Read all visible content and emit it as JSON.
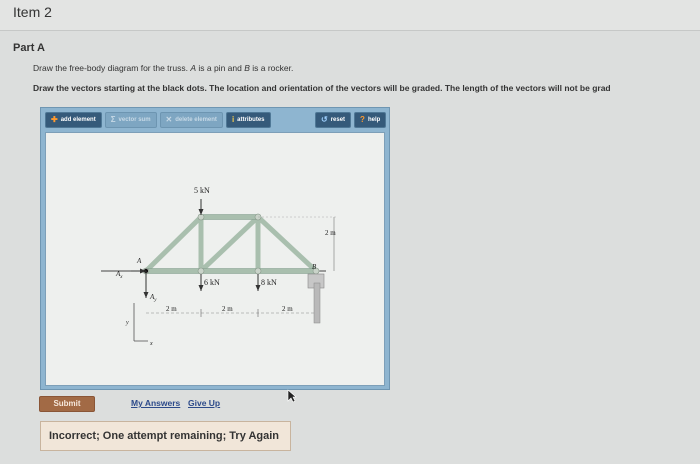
{
  "item": {
    "title": "Item 2"
  },
  "part": {
    "title": "Part A",
    "instruction_prefix": "Draw the free-body diagram for the truss. ",
    "instruction_var_a": "A",
    "instruction_mid1": " is a pin and ",
    "instruction_var_b": "B",
    "instruction_mid2": " is a rocker.",
    "instruction_bold": "Draw the vectors starting at the black dots. The location and orientation of the vectors will be graded. The length of the vectors will not be grad"
  },
  "toolbar": {
    "add_element": "add element",
    "vector_sum": "vector sum",
    "delete_element": "delete element",
    "attributes": "attributes",
    "reset": "reset",
    "help": "help"
  },
  "diagram": {
    "load_top": "5 kN",
    "load_mid": "6 kN",
    "load_right": "8 kN",
    "dim_1": "2 m",
    "dim_2": "2 m",
    "dim_3": "2 m",
    "height": "2 m",
    "label_a": "A",
    "label_b": "B",
    "label_ax": "A",
    "label_ax_sub": "x",
    "label_ay": "A",
    "label_ay_sub": "y",
    "axis_y": "y",
    "axis_x": "x"
  },
  "actions": {
    "submit": "Submit",
    "my_answers": "My Answers",
    "give_up": "Give Up"
  },
  "feedback": {
    "text": "Incorrect; One attempt remaining; Try Again"
  },
  "colors": {
    "applet_blue": "#8eb5d0",
    "truss_green": "#a9bfae",
    "submit_brown": "#a26a45",
    "feedback_bg": "#f1e6d9"
  }
}
